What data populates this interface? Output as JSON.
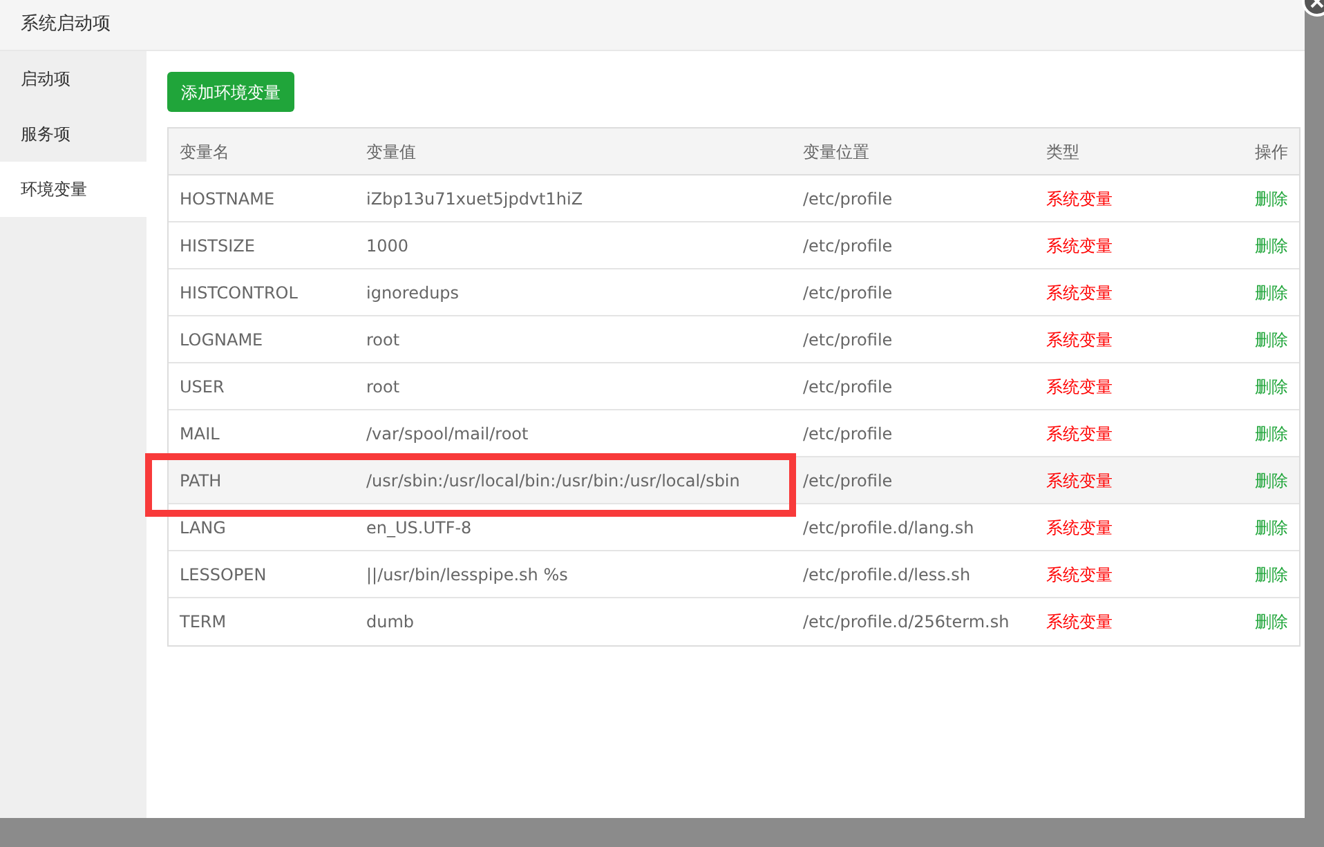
{
  "window": {
    "title": "系统启动项"
  },
  "sidebar": {
    "items": [
      {
        "label": "启动项",
        "selected": false
      },
      {
        "label": "服务项",
        "selected": false
      },
      {
        "label": "环境变量",
        "selected": true
      }
    ]
  },
  "add_button": "添加环境变量",
  "table": {
    "columns": [
      "变量名",
      "变量值",
      "变量位置",
      "类型",
      "操作"
    ],
    "rows": [
      {
        "name": "HOSTNAME",
        "value": "iZbp13u71xuet5jpdvt1hiZ",
        "location": "/etc/profile",
        "type": "系统变量",
        "action": "删除",
        "highlighted": false,
        "annotated": false
      },
      {
        "name": "HISTSIZE",
        "value": "1000",
        "location": "/etc/profile",
        "type": "系统变量",
        "action": "删除",
        "highlighted": false,
        "annotated": false
      },
      {
        "name": "HISTCONTROL",
        "value": "ignoredups",
        "location": "/etc/profile",
        "type": "系统变量",
        "action": "删除",
        "highlighted": false,
        "annotated": false
      },
      {
        "name": "LOGNAME",
        "value": "root",
        "location": "/etc/profile",
        "type": "系统变量",
        "action": "删除",
        "highlighted": false,
        "annotated": false
      },
      {
        "name": "USER",
        "value": "root",
        "location": "/etc/profile",
        "type": "系统变量",
        "action": "删除",
        "highlighted": false,
        "annotated": false
      },
      {
        "name": "MAIL",
        "value": "/var/spool/mail/root",
        "location": "/etc/profile",
        "type": "系统变量",
        "action": "删除",
        "highlighted": false,
        "annotated": false
      },
      {
        "name": "PATH",
        "value": "/usr/sbin:/usr/local/bin:/usr/bin:/usr/local/sbin",
        "location": "/etc/profile",
        "type": "系统变量",
        "action": "删除",
        "highlighted": true,
        "annotated": true
      },
      {
        "name": "LANG",
        "value": "en_US.UTF-8",
        "location": "/etc/profile.d/lang.sh",
        "type": "系统变量",
        "action": "删除",
        "highlighted": false,
        "annotated": false
      },
      {
        "name": "LESSOPEN",
        "value": "||/usr/bin/lesspipe.sh %s",
        "location": "/etc/profile.d/less.sh",
        "type": "系统变量",
        "action": "删除",
        "highlighted": false,
        "annotated": false
      },
      {
        "name": "TERM",
        "value": "dumb",
        "location": "/etc/profile.d/256term.sh",
        "type": "系统变量",
        "action": "删除",
        "highlighted": false,
        "annotated": false
      }
    ]
  }
}
